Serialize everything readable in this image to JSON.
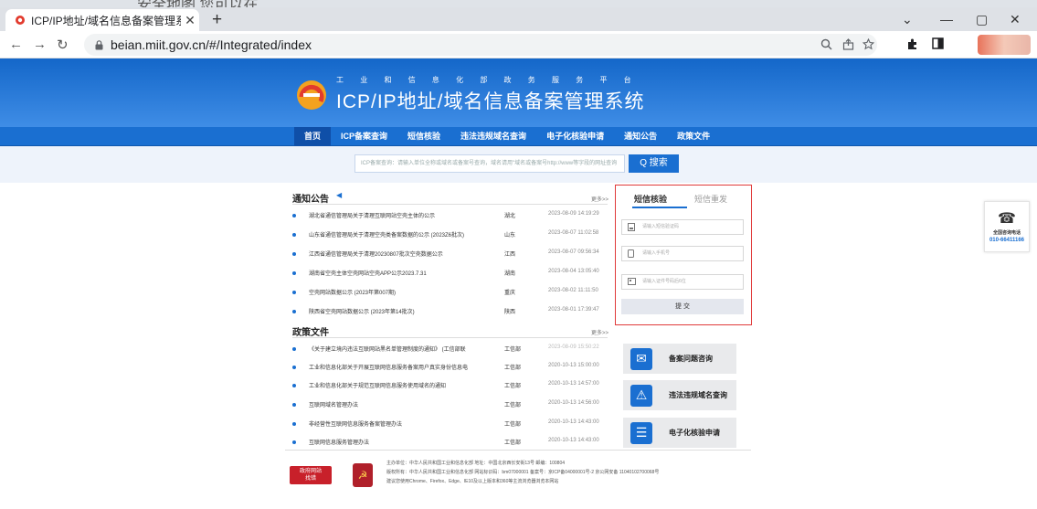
{
  "browser": {
    "top_partial_text": "安全地图 您可以在",
    "tab_title": "ICP/IP地址/域名信息备案管理系",
    "url": "beian.miit.gov.cn/#/Integrated/index"
  },
  "hero": {
    "subtitle": "工 业 和 信 息 化 部 政 务 服 务 平 台",
    "title": "ICP/IP地址/域名信息备案管理系统"
  },
  "menu": [
    "首页",
    "ICP备案查询",
    "短信核验",
    "违法违规域名查询",
    "电子化核验申请",
    "通知公告",
    "政策文件"
  ],
  "search": {
    "placeholder": "ICP备案查询：请输入单位全称或域名或备案号查询，域名请用\"域名或备案号http://www等字段的网址查询",
    "button": "Q 搜索"
  },
  "notices": {
    "heading": "通知公告",
    "more": "更多>>",
    "items": [
      {
        "title": "湖北省通信管理局关于清理互联网站空壳主体的公示",
        "region": "湖北",
        "date": "2023-08-09 14:19:29"
      },
      {
        "title": "山东省通信管理局关于清理空壳类备案数据的公示 (2023Z6批次)",
        "region": "山东",
        "date": "2023-08-07 11:02:58"
      },
      {
        "title": "江西省通信管理局关于清理20230807批次空壳数据公示",
        "region": "江西",
        "date": "2023-08-07 09:56:34"
      },
      {
        "title": "湖南省空壳主体空壳网站空壳APP公示2023.7.31",
        "region": "湖南",
        "date": "2023-08-04 13:05:40"
      },
      {
        "title": "空壳网站数据公示 (2023年第007期)",
        "region": "重庆",
        "date": "2023-08-02 11:11:50"
      },
      {
        "title": "陕西省空壳网站数据公示 (2023年第14批次)",
        "region": "陕西",
        "date": "2023-08-01 17:39:47"
      }
    ]
  },
  "policies": {
    "heading": "政策文件",
    "more": "更多>>",
    "items": [
      {
        "title": "《关于建立境内违法互联网站黑名单管理制度的通知》 (工信部联",
        "region": "工信部",
        "date": "2023-08-09 15:50:22"
      },
      {
        "title": "工业和信息化部关于开展互联网信息服务备案用户真实身份信息电",
        "region": "工信部",
        "date": "2020-10-13 15:00:00"
      },
      {
        "title": "工业和信息化部关于规范互联网信息服务使用域名的通知",
        "region": "工信部",
        "date": "2020-10-13 14:57:00"
      },
      {
        "title": "互联网域名管理办法",
        "region": "工信部",
        "date": "2020-10-13 14:56:00"
      },
      {
        "title": "非经营性互联网信息服务备案管理办法",
        "region": "工信部",
        "date": "2020-10-13 14:43:00"
      },
      {
        "title": "互联网信息服务管理办法",
        "region": "工信部",
        "date": "2020-10-13 14:43:00"
      }
    ]
  },
  "sms_panel": {
    "tab_active": "短信核验",
    "tab_other": "短信重发",
    "field_code": "请输入短信验证码",
    "field_phone": "请输入手机号",
    "field_id": "请输入证件号码后6位",
    "submit": "提 交"
  },
  "quick_links": [
    "备案问题咨询",
    "违法违规域名查询",
    "电子化核验申请"
  ],
  "hotline": {
    "label": "全国咨询电话",
    "number": "010-66411166"
  },
  "footer": {
    "gov_badge": "政府网站\n找错",
    "line1": "主办单位：中华人民共和国工业和信息化部    地址：中国北京西长安街13号    邮编：100804",
    "line2": "版权所有：中华人民共和国工业和信息化部    网站标识码：bm07000001    备案号：京ICP备04000001号-2    京公网安备 11040102700068号",
    "line3": "建议您使用Chrome、Firefox、Edge、IE10及以上版本和360等主流浏览器浏览本网站"
  },
  "colors": {
    "primary": "#1a6fd1",
    "highlight_border": "#e03a3a"
  }
}
